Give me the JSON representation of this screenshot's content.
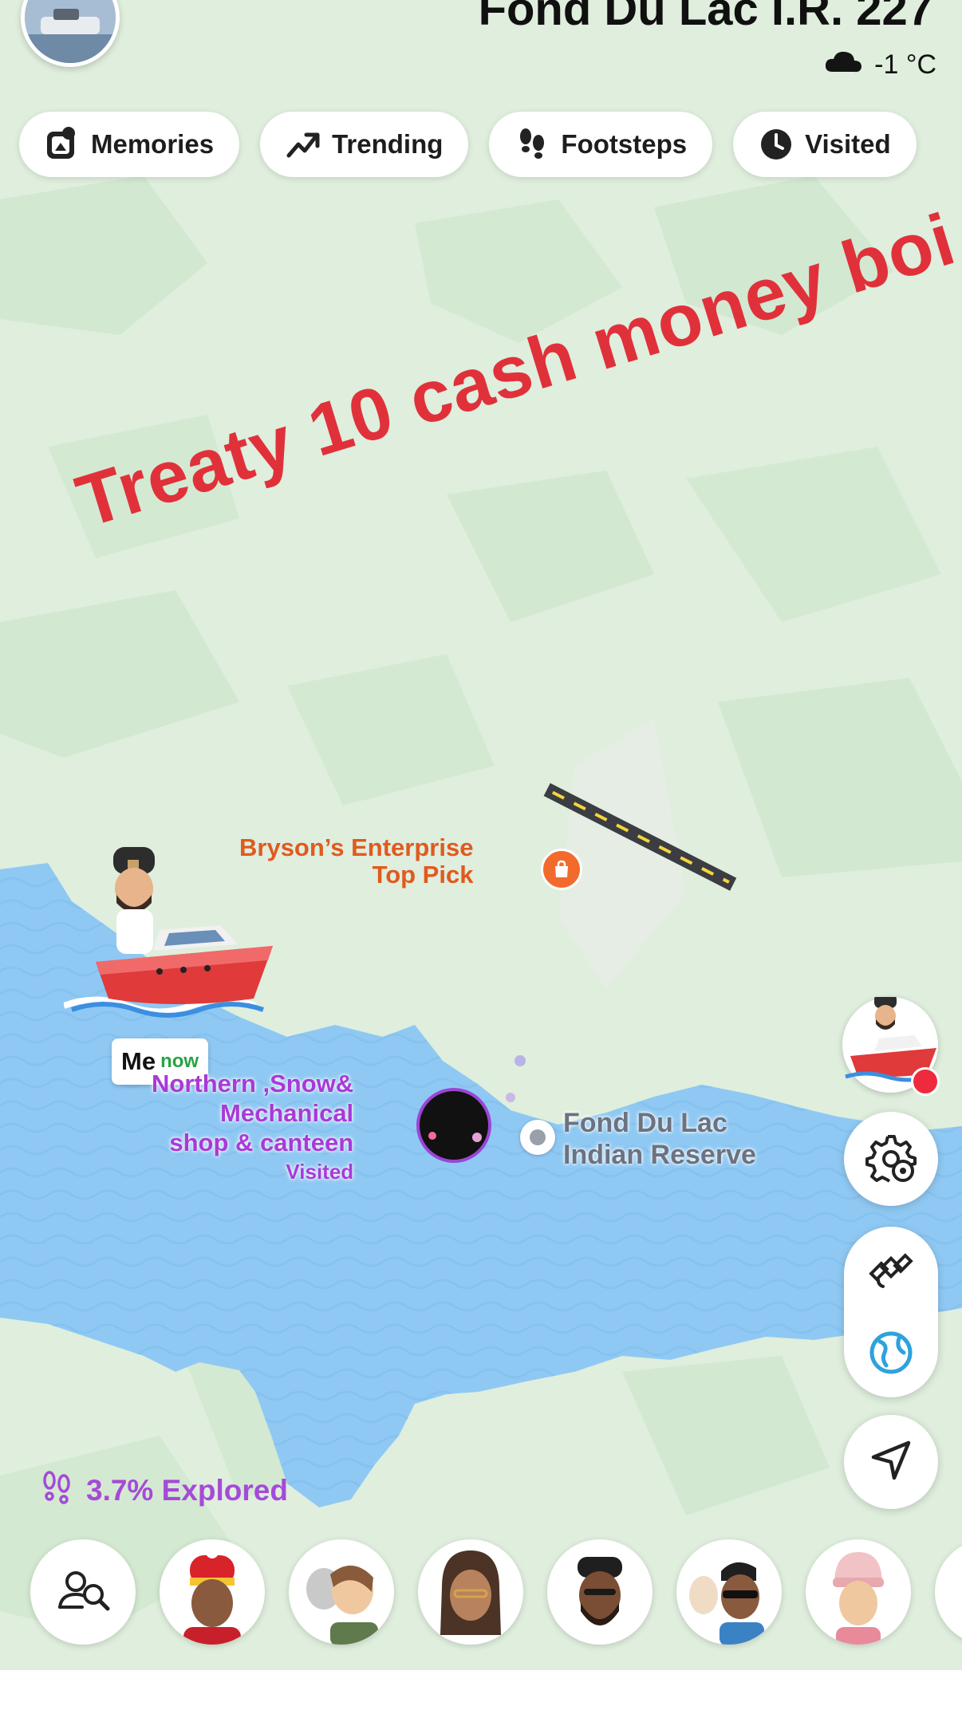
{
  "header": {
    "location_title": "Fond Du Lac I.R. 227",
    "weather": {
      "icon": "cloud-icon",
      "temperature": "-1 °C"
    }
  },
  "chips": [
    {
      "label": "Memories",
      "icon": "memories-icon"
    },
    {
      "label": "Trending",
      "icon": "trending-arrow-icon"
    },
    {
      "label": "Footsteps",
      "icon": "footsteps-icon"
    },
    {
      "label": "Visited",
      "icon": "clock-icon"
    }
  ],
  "overlay_caption": "Treaty 10 cash money boi",
  "map": {
    "poi_bryson": {
      "name": "Bryson’s Enterprise",
      "tag": "Top Pick",
      "icon": "shopping-bag-icon"
    },
    "poi_northern": {
      "line1": "Northern ,Snow&",
      "line2": "Mechanical",
      "line3": "shop & canteen",
      "status": "Visited"
    },
    "reserve": {
      "line1": "Fond Du Lac",
      "line2": "Indian Reserve"
    },
    "me_label": {
      "name": "Me",
      "time": "now"
    }
  },
  "controls": {
    "settings_icon": "map-settings-gear-icon",
    "satellite_icon": "satellite-icon",
    "globe_icon": "globe-icon",
    "locate_icon": "navigation-arrow-icon"
  },
  "explored": {
    "text": "3.7% Explored",
    "icon": "footprints-icon",
    "percent": 3.7
  },
  "colors": {
    "land": "#dfeedd",
    "water": "#8fc9f3",
    "caption_red": "#e0313b",
    "poi_purple": "#a83ad8",
    "poi_orange": "#e05a1f"
  }
}
